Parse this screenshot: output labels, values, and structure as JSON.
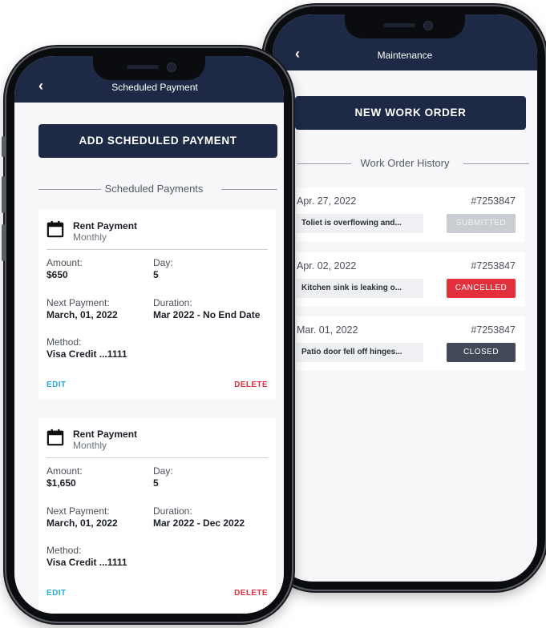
{
  "maintenance": {
    "back_icon": "‹",
    "title": "Maintenance",
    "new_work_order_label": "NEW WORK ORDER",
    "history_title": "Work Order History",
    "work_orders": [
      {
        "date": "Apr. 27, 2022",
        "id": "#7253847",
        "description": "Toliet is overflowing and...",
        "status": "SUBMITTED",
        "status_color": "#c9ccd1",
        "status_text_color": "#f4f5f7"
      },
      {
        "date": "Apr. 02, 2022",
        "id": "#7253847",
        "description": "Kitchen sink is leaking o...",
        "status": "CANCELLED",
        "status_color": "#e2303d",
        "status_text_color": "#ffffff"
      },
      {
        "date": "Mar. 01, 2022",
        "id": "#7253847",
        "description": "Patio door fell off hinges...",
        "status": "CLOSED",
        "status_color": "#434a57",
        "status_text_color": "#ffffff"
      }
    ]
  },
  "scheduled": {
    "back_icon": "‹",
    "title": "Scheduled Payment",
    "add_label": "ADD SCHEDULED PAYMENT",
    "list_title": "Scheduled Payments",
    "payments": [
      {
        "name": "Rent Payment",
        "frequency": "Monthly",
        "amount_label": "Amount:",
        "amount": "$650",
        "day_label": "Day:",
        "day": "5",
        "next_label": "Next Payment:",
        "next": "March, 01, 2022",
        "duration_label": "Duration:",
        "duration": "Mar 2022 - No End Date",
        "method_label": "Method:",
        "method": "Visa Credit ...1111",
        "edit_label": "EDIT",
        "delete_label": "DELETE"
      },
      {
        "name": "Rent Payment",
        "frequency": "Monthly",
        "amount_label": "Amount:",
        "amount": "$1,650",
        "day_label": "Day:",
        "day": "5",
        "next_label": "Next Payment:",
        "next": "March, 01, 2022",
        "duration_label": "Duration:",
        "duration": "Mar 2022 - Dec 2022",
        "method_label": "Method:",
        "method": "Visa Credit ...1111",
        "edit_label": "EDIT",
        "delete_label": "DELETE"
      }
    ]
  },
  "colors": {
    "navy": "#1e2a45",
    "edit": "#28a9e0",
    "delete": "#e0303d"
  }
}
